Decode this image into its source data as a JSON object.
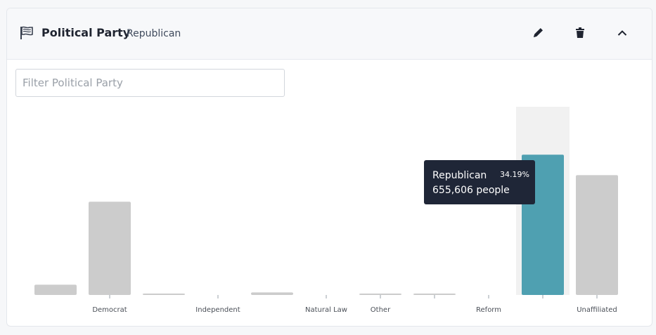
{
  "header": {
    "title": "Political Party",
    "selected_value": "Republican",
    "icons": {
      "flag": "flag-icon",
      "edit": "pencil-icon",
      "delete": "trash-icon",
      "collapse": "chevron-up-icon"
    }
  },
  "filter": {
    "placeholder": "Filter Political Party",
    "value": ""
  },
  "tooltip": {
    "name": "Republican",
    "percent": "34.19%",
    "people": "655,606 people"
  },
  "colors": {
    "bar": "#cccccc",
    "highlight_bar": "#4fa0b1",
    "hover_band": "#f1f1f1",
    "tooltip_bg": "#1f2637"
  },
  "chart_data": {
    "type": "bar",
    "categories": [
      "",
      "Democrat",
      "",
      "Independent",
      "",
      "Natural Law",
      "Other",
      "",
      "Reform",
      "",
      "Unaffiliated"
    ],
    "values": [
      48000,
      436000,
      5000,
      0,
      12000,
      0,
      2000,
      5000,
      0,
      655606,
      560000
    ],
    "highlighted_index": 9,
    "ylim": [
      0,
      870000
    ],
    "grid": false,
    "legend": "none"
  }
}
